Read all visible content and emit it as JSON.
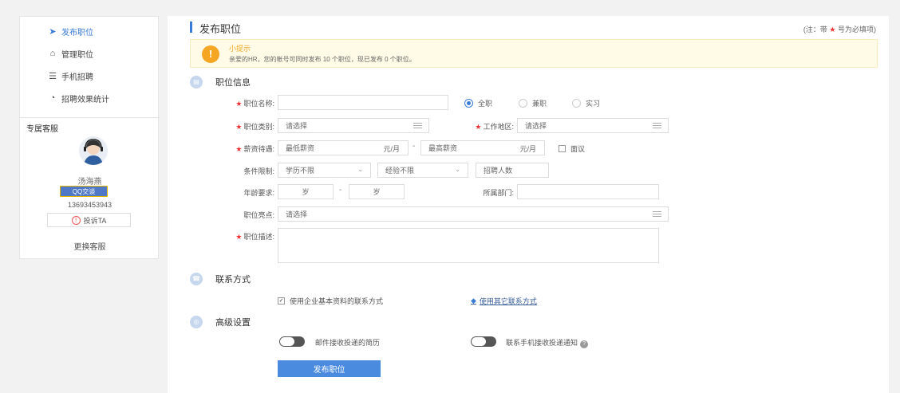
{
  "sidebar": {
    "nav": [
      {
        "icon": "paper-plane-icon",
        "glyph": "➤",
        "label": "发布职位"
      },
      {
        "icon": "folder-icon",
        "glyph": "⌂",
        "label": "管理职位"
      },
      {
        "icon": "handshake-icon",
        "glyph": "☰",
        "label": "手机招聘"
      },
      {
        "icon": "pie-chart-icon",
        "glyph": "◔",
        "label": "招聘效果统计"
      }
    ],
    "service_title": "专属客服",
    "service_name": "汤海燕",
    "qq_label": "QQ交谈",
    "service_phone": "13693453943",
    "complain_label": "投诉TA",
    "change_service": "更换客服"
  },
  "page": {
    "title": "发布职位",
    "note_prefix": "(注：带",
    "note_star": "★",
    "note_suffix": "号为必填项)"
  },
  "tip": {
    "title": "小提示",
    "text": "亲爱的HR，您的帐号可同时发布 10 个职位，现已发布 0 个职位。"
  },
  "sections": {
    "job_info": "职位信息",
    "contact": "联系方式",
    "advanced": "高级设置"
  },
  "form": {
    "job_name_label": "职位名称:",
    "job_name_value": "",
    "job_type_options": [
      "全职",
      "兼职",
      "实习"
    ],
    "job_type_selected": "全职",
    "category_label": "职位类别:",
    "category_value": "请选择",
    "area_label": "工作地区:",
    "area_value": "请选择",
    "salary_label": "薪资待遇:",
    "salary_min": "最低薪资",
    "salary_max": "最高薪资",
    "salary_unit": "元/月",
    "negotiable": "面议",
    "condition_label": "条件限制:",
    "education": "学历不限",
    "experience": "经验不限",
    "headcount_placeholder": "招聘人数",
    "age_label": "年龄要求:",
    "age_unit": "岁",
    "dept_label": "所属部门:",
    "dept_value": "",
    "highlight_label": "职位亮点:",
    "highlight_value": "请选择",
    "desc_label": "职位描述:",
    "desc_value": ""
  },
  "contact": {
    "use_company": "使用企业基本资料的联系方式",
    "use_other": "使用其它联系方式"
  },
  "advanced": {
    "email_resume": "邮件接收投递的简历",
    "sms_notify": "联系手机接收投递通知"
  },
  "submit_label": "发布职位",
  "colors": {
    "accent": "#3a7bd5",
    "button": "#4a8be0",
    "required_star": "#e33333",
    "tip_bg": "#fffbe6",
    "tip_icon": "#f5a623"
  }
}
